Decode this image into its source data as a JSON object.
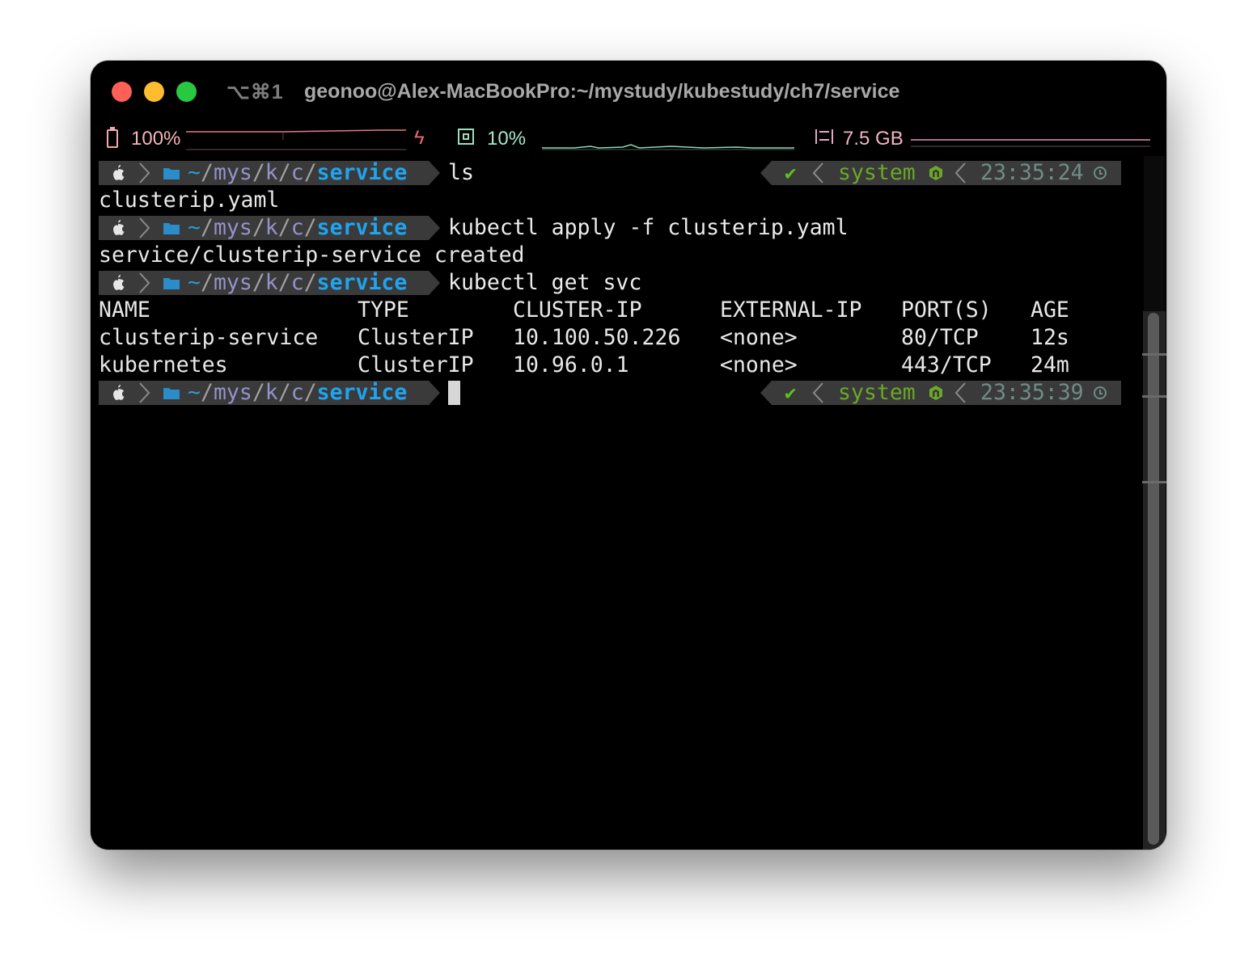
{
  "window": {
    "shortcut": "⌥⌘1",
    "title": "geonoo@Alex-MacBookPro:~/mystudy/kubestudy/ch7/service"
  },
  "status": {
    "battery": "100%",
    "cpu": "10%",
    "memory": "7.5 GB",
    "icons": [
      "battery-icon",
      "bolt-icon",
      "cpu-icon",
      "memory-icon"
    ]
  },
  "prompt": {
    "path_tilde": "~",
    "path_seg1": "mys",
    "path_seg2": "k",
    "path_seg3": "c",
    "path_slash": "/",
    "path_current": "service",
    "check": "✔",
    "context": "system"
  },
  "session": {
    "cmd1": "ls",
    "time1": "23:35:24",
    "out1": "clusterip.yaml",
    "cmd2": "kubectl apply -f clusterip.yaml",
    "out2": "service/clusterip-service created",
    "cmd3": "kubectl get svc",
    "time4": "23:35:39"
  },
  "table": {
    "headers": [
      "NAME",
      "TYPE",
      "CLUSTER-IP",
      "EXTERNAL-IP",
      "PORT(S)",
      "AGE"
    ],
    "rows": [
      [
        "clusterip-service",
        "ClusterIP",
        "10.100.50.226",
        "<none>",
        "80/TCP",
        "12s"
      ],
      [
        "kubernetes",
        "ClusterIP",
        "10.96.0.1",
        "<none>",
        "443/TCP",
        "24m"
      ]
    ]
  },
  "colors": {
    "path_blue": "#20a4f0",
    "status_green": "#6aa826",
    "battery_pink": "#f3b3b9",
    "cpu_mint": "#a7e6c9"
  }
}
